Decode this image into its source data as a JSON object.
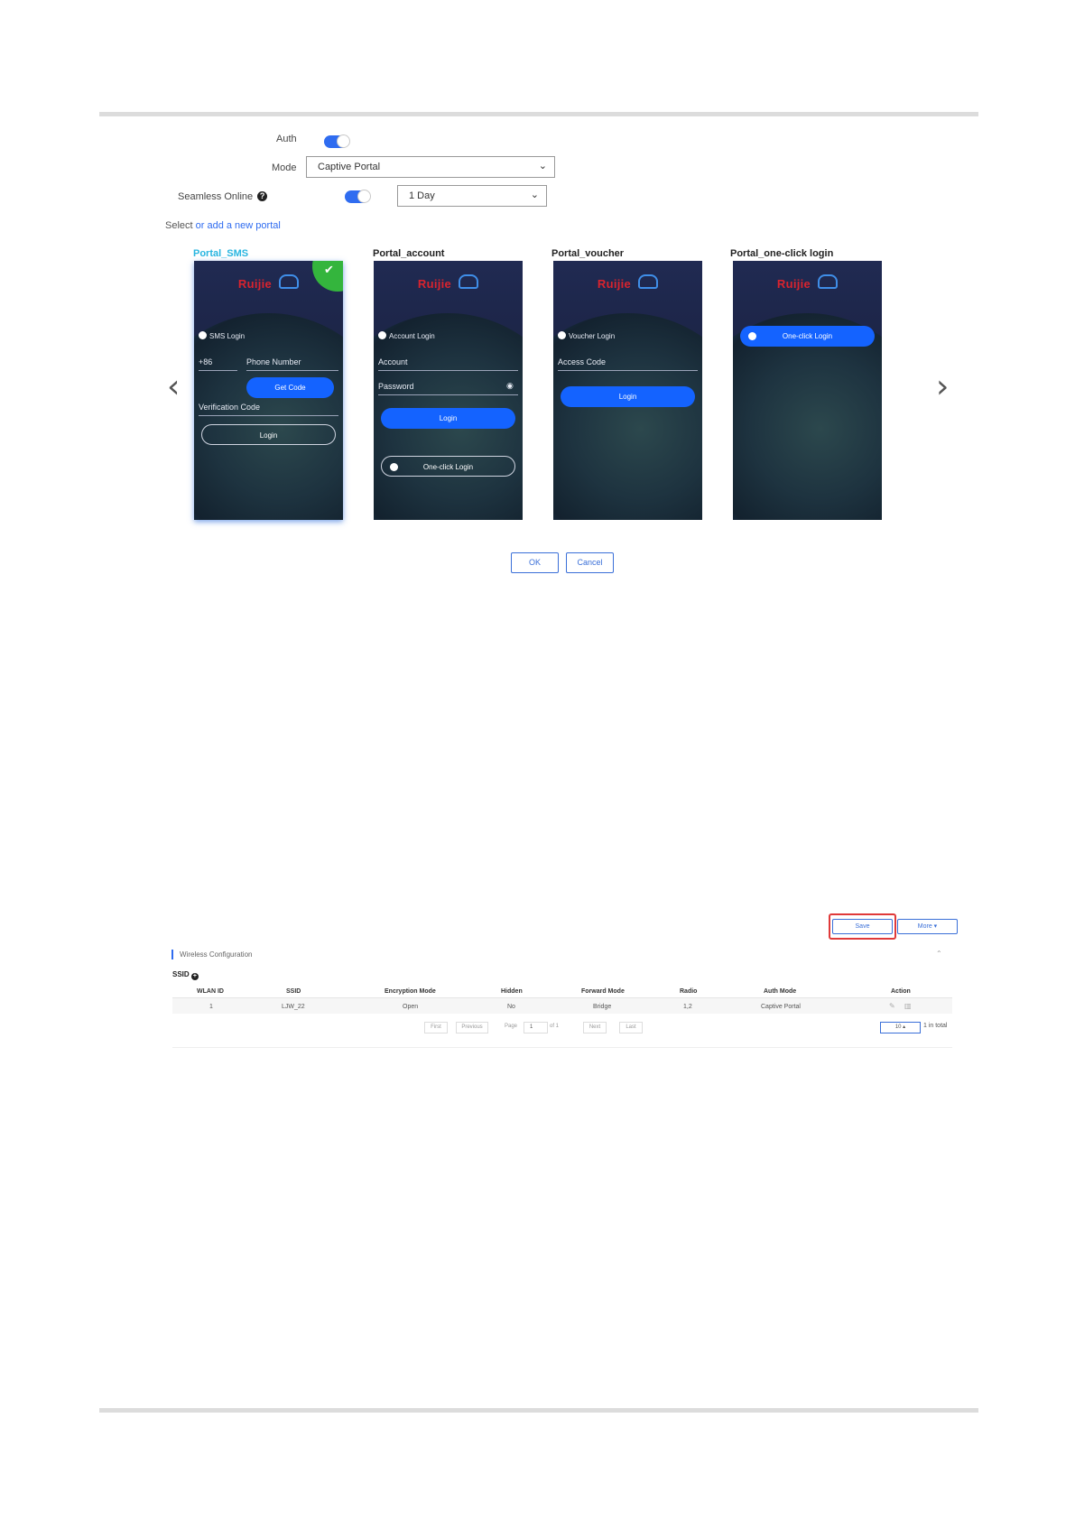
{
  "auth": {
    "label": "Auth"
  },
  "mode": {
    "label": "Mode",
    "value": "Captive Portal"
  },
  "seamless": {
    "label": "Seamless Online",
    "duration": "1 Day"
  },
  "portal_select": {
    "prefix": "Select",
    "link": "or add a new portal"
  },
  "portals": [
    {
      "title": "Portal_SMS",
      "brand": "Ruijie"
    },
    {
      "title": "Portal_account",
      "brand": "Ruijie"
    },
    {
      "title": "Portal_voucher",
      "brand": "Ruijie"
    },
    {
      "title": "Portal_one-click login",
      "brand": "Ruijie"
    }
  ],
  "sms_card": {
    "heading": "SMS Login",
    "country_code": "+86",
    "phone": "Phone Number",
    "get_code": "Get Code",
    "verification": "Verification Code",
    "login": "Login"
  },
  "account_card": {
    "heading": "Account Login",
    "account": "Account",
    "password": "Password",
    "login": "Login",
    "one_click": "One-click Login"
  },
  "voucher_card": {
    "heading": "Voucher Login",
    "access_code": "Access Code",
    "login": "Login"
  },
  "oneclick_card": {
    "button": "One-click Login"
  },
  "dialog": {
    "ok": "OK",
    "cancel": "Cancel"
  },
  "toolbar": {
    "save": "Save",
    "more": "More ▾"
  },
  "section": {
    "title": "Wireless Configuration",
    "ssid_label": "SSID"
  },
  "table": {
    "headers": [
      "WLAN ID",
      "SSID",
      "Encryption Mode",
      "Hidden",
      "Forward Mode",
      "Radio",
      "Auth Mode",
      "Action"
    ],
    "rows": [
      [
        "1",
        "LJW_22",
        "Open",
        "No",
        "Bridge",
        "1,2",
        "Captive Portal"
      ]
    ]
  },
  "pagination": {
    "first": "First",
    "previous": "Previous",
    "page_label": "Page",
    "page": "1",
    "of": "of 1",
    "next": "Next",
    "last": "Last",
    "page_size": "10 ▴",
    "total": "1 in total"
  }
}
